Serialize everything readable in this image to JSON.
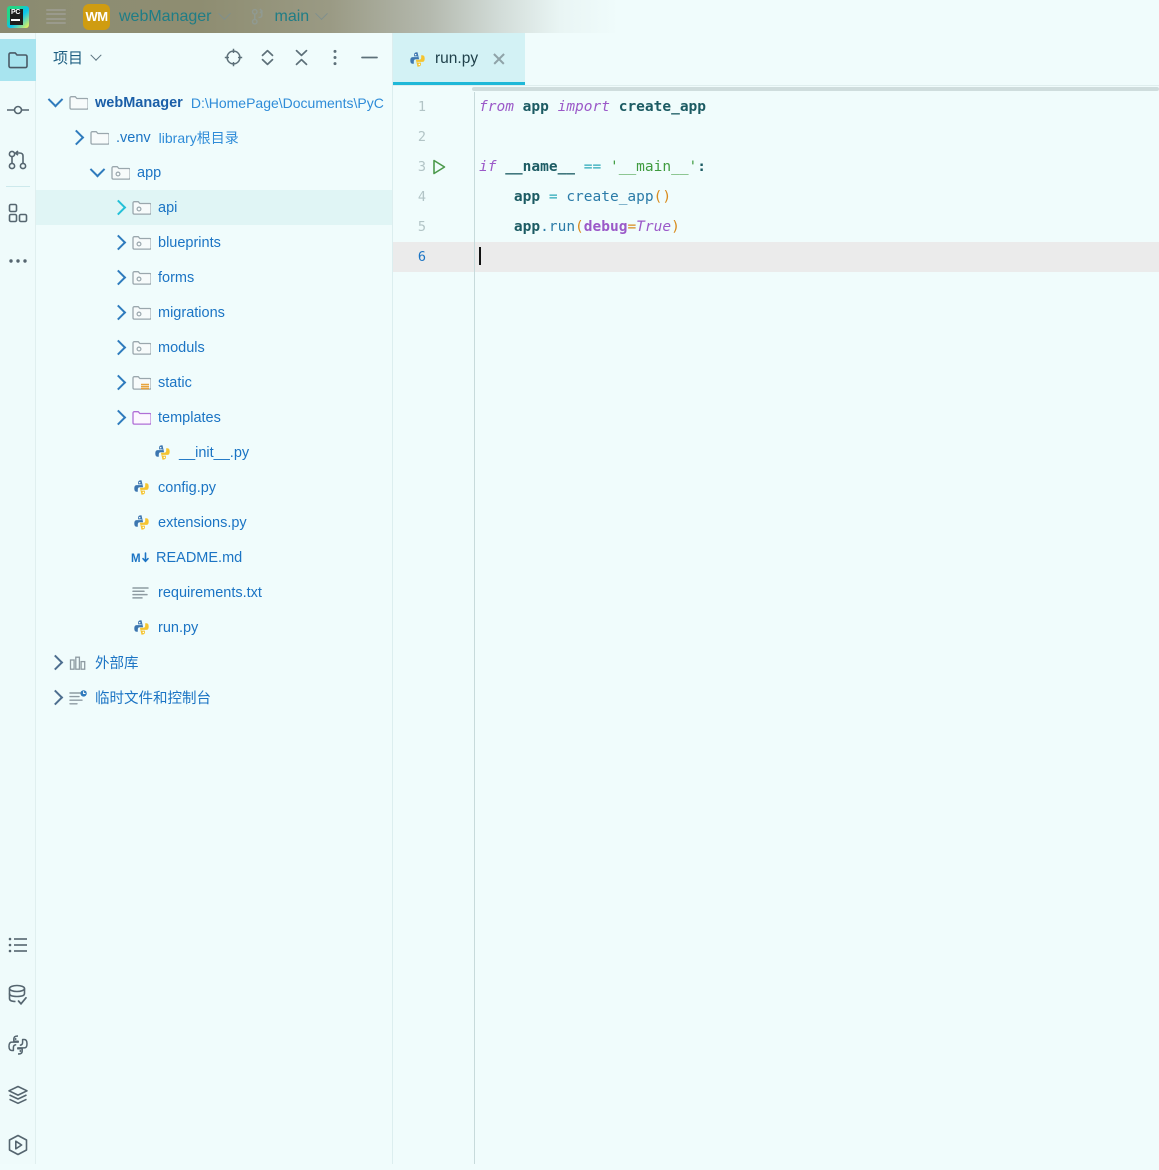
{
  "titlebar": {
    "logo_icon": "pycharm-logo-icon",
    "logo_text": "PC",
    "menu_icon": "hamburger-menu-icon",
    "project_badge": "WM",
    "project_name": "webManager",
    "project_chevron_icon": "chevron-down-icon",
    "branch_icon": "git-branch-icon",
    "branch_name": "main",
    "branch_chevron_icon": "chevron-down-icon"
  },
  "rail": {
    "top_items": [
      {
        "name": "project-tool-window",
        "icon": "folder-icon",
        "active": true
      },
      {
        "name": "commit-tool-window",
        "icon": "commit-icon",
        "active": false
      },
      {
        "name": "pull-requests-tool-window",
        "icon": "git-branch-merge-icon",
        "active": false
      },
      {
        "name": "structure-tool-window",
        "icon": "blocks-icon",
        "active": false
      },
      {
        "name": "more-tool-windows",
        "icon": "ellipsis-icon",
        "active": false
      }
    ],
    "bottom_items": [
      {
        "name": "todo-tool-window",
        "icon": "list-icon"
      },
      {
        "name": "database-tool-window",
        "icon": "database-check-icon"
      },
      {
        "name": "python-console-tool-window",
        "icon": "python-icon"
      },
      {
        "name": "services-tool-window",
        "icon": "layers-icon"
      },
      {
        "name": "run-tool-window",
        "icon": "run-hexagon-icon"
      }
    ]
  },
  "project_panel": {
    "title": "项目",
    "title_chevron_icon": "chevron-down-icon",
    "tools": [
      {
        "name": "select-opened-file-button",
        "icon": "crosshair-target-icon"
      },
      {
        "name": "expand-all-button",
        "icon": "expand-chevrons-icon"
      },
      {
        "name": "collapse-all-button",
        "icon": "collapse-chevrons-icon"
      },
      {
        "name": "options-button",
        "icon": "vertical-dots-icon"
      },
      {
        "name": "hide-panel-button",
        "icon": "minimize-dash-icon"
      }
    ],
    "tree": [
      {
        "id": "webManager",
        "label": "webManager",
        "sub": "D:\\HomePage\\Documents\\PyC",
        "indent": 0,
        "arrow": "down",
        "icon": "folder-root-icon",
        "bold": true,
        "selected": false
      },
      {
        "id": "venv",
        "label": ".venv",
        "sub": "library根目录",
        "indent": 1,
        "arrow": "right",
        "icon": "folder-icon",
        "bold": false,
        "selected": false
      },
      {
        "id": "app",
        "label": "app",
        "sub": "",
        "indent": 1,
        "arrow": "down",
        "icon": "folder-package-icon",
        "bold": false,
        "selected": false
      },
      {
        "id": "api",
        "label": "api",
        "sub": "",
        "indent": 2,
        "arrow": "right-cyan",
        "icon": "folder-package-icon",
        "bold": false,
        "selected": true
      },
      {
        "id": "blueprints",
        "label": "blueprints",
        "sub": "",
        "indent": 2,
        "arrow": "right",
        "icon": "folder-package-icon",
        "bold": false,
        "selected": false
      },
      {
        "id": "forms",
        "label": "forms",
        "sub": "",
        "indent": 2,
        "arrow": "right",
        "icon": "folder-package-icon",
        "bold": false,
        "selected": false
      },
      {
        "id": "migrations",
        "label": "migrations",
        "sub": "",
        "indent": 2,
        "arrow": "right",
        "icon": "folder-package-icon",
        "bold": false,
        "selected": false
      },
      {
        "id": "moduls",
        "label": "moduls",
        "sub": "",
        "indent": 2,
        "arrow": "right",
        "icon": "folder-package-icon",
        "bold": false,
        "selected": false
      },
      {
        "id": "static",
        "label": "static",
        "sub": "",
        "indent": 2,
        "arrow": "right",
        "icon": "folder-resource-icon",
        "bold": false,
        "selected": false
      },
      {
        "id": "templates",
        "label": "templates",
        "sub": "",
        "indent": 2,
        "arrow": "right",
        "icon": "folder-template-icon",
        "bold": false,
        "selected": false
      },
      {
        "id": "init",
        "label": "__init__.py",
        "sub": "",
        "indent": 3,
        "arrow": "none",
        "icon": "python-file-icon",
        "bold": false,
        "selected": false
      },
      {
        "id": "config",
        "label": "config.py",
        "sub": "",
        "indent": 2,
        "arrow": "none",
        "icon": "python-file-icon",
        "bold": false,
        "selected": false
      },
      {
        "id": "extensions",
        "label": "extensions.py",
        "sub": "",
        "indent": 2,
        "arrow": "none",
        "icon": "python-file-icon",
        "bold": false,
        "selected": false
      },
      {
        "id": "readme",
        "label": "README.md",
        "sub": "",
        "indent": 2,
        "arrow": "none",
        "icon": "markdown-file-icon",
        "bold": false,
        "selected": false
      },
      {
        "id": "requirements",
        "label": "requirements.txt",
        "sub": "",
        "indent": 2,
        "arrow": "none",
        "icon": "text-file-icon",
        "bold": false,
        "selected": false
      },
      {
        "id": "runpy",
        "label": "run.py",
        "sub": "",
        "indent": 2,
        "arrow": "none",
        "icon": "python-file-icon",
        "bold": false,
        "selected": false
      },
      {
        "id": "ext-libs",
        "label": "外部库",
        "sub": "",
        "indent": 0,
        "arrow": "right-gray",
        "icon": "library-icon",
        "bold": false,
        "selected": false
      },
      {
        "id": "scratches",
        "label": "临时文件和控制台",
        "sub": "",
        "indent": 0,
        "arrow": "right-gray",
        "icon": "scratches-icon",
        "bold": false,
        "selected": false
      }
    ]
  },
  "editor": {
    "tab": {
      "label": "run.py",
      "icon": "python-file-icon",
      "close_icon": "close-icon",
      "active": true
    },
    "gutter": {
      "line_numbers": [
        "1",
        "2",
        "3",
        "4",
        "5",
        "6"
      ],
      "run_marker_line": 3,
      "run_marker_icon": "run-triangle-icon",
      "current_line": 6
    },
    "code_lines": [
      {
        "n": 1,
        "text": "from app import create_app"
      },
      {
        "n": 2,
        "text": ""
      },
      {
        "n": 3,
        "text": "if __name__ == '__main__':"
      },
      {
        "n": 4,
        "text": "    app = create_app()"
      },
      {
        "n": 5,
        "text": "    app.run(debug=True)"
      },
      {
        "n": 6,
        "text": ""
      }
    ],
    "language": "python",
    "scrollbar": {
      "name": "horizontal-scrollbar"
    }
  },
  "colors": {
    "accent_cyan": "#1fb8d8",
    "selection_bg": "#e0f5f5",
    "tab_active_bg": "#d3f2f5",
    "badge_amber": "#cf9c11",
    "link_blue": "#1b74c4",
    "keyword_purple": "#9b59c8",
    "string_green": "#3f9b3f",
    "bg": "#f0fcfc"
  }
}
